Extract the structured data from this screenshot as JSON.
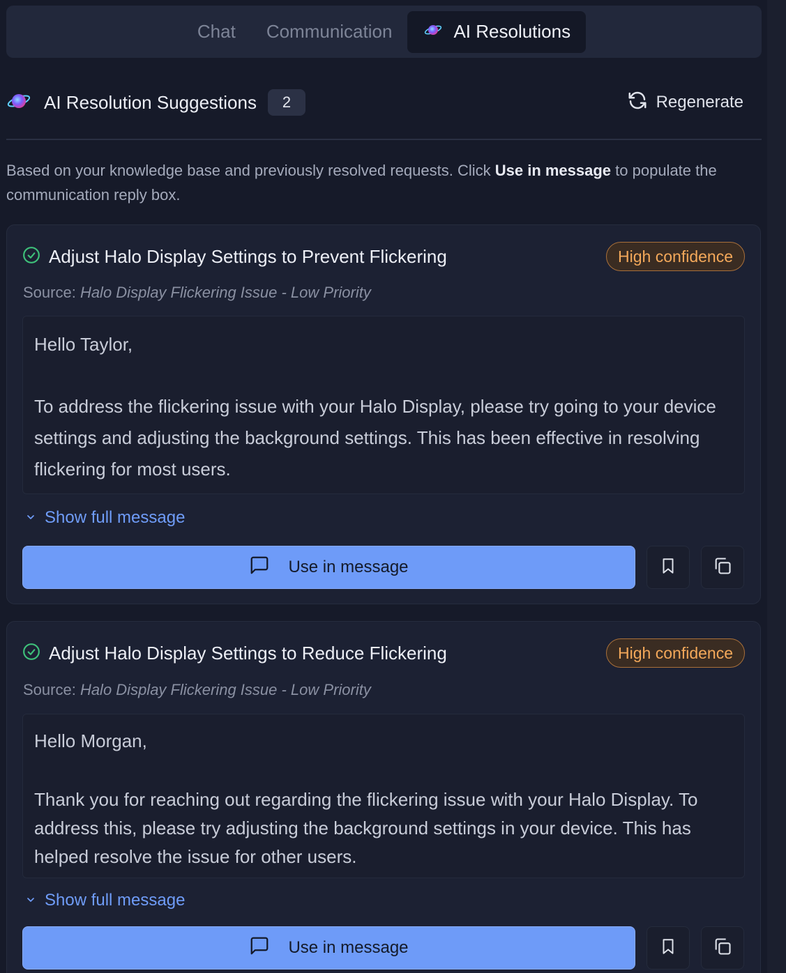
{
  "tabs": [
    {
      "label": "Chat"
    },
    {
      "label": "Communication"
    },
    {
      "label": "AI Resolutions"
    }
  ],
  "header": {
    "title": "AI Resolution Suggestions",
    "count": "2",
    "regenerate_label": "Regenerate"
  },
  "intro": {
    "before": "Based on your knowledge base and previously resolved requests. Click ",
    "bold": "Use in message",
    "after": " to populate the communication reply box."
  },
  "suggestions": [
    {
      "title": "Adjust Halo Display Settings to Prevent Flickering",
      "confidence": "High confidence",
      "source_label": "Source: ",
      "source": "Halo Display Flickering Issue - Low Priority",
      "greeting": "Hello Taylor,",
      "body": "To address the flickering issue with your Halo Display, please try going to your device settings and adjusting the background settings. This has been effective in resolving flickering for most users.",
      "show_full": "Show full message",
      "use_label": "Use in message"
    },
    {
      "title": "Adjust Halo Display Settings to Reduce Flickering",
      "confidence": "High confidence",
      "source_label": "Source: ",
      "source": "Halo Display Flickering Issue - Low Priority",
      "greeting": "Hello Morgan,",
      "body": "Thank you for reaching out regarding the flickering issue with your Halo Display. To address this, please try adjusting the background settings in your device. This has helped resolve the issue for other users.",
      "show_full": "Show full message",
      "use_label": "Use in message"
    }
  ],
  "icons": {
    "ai": "ai-orb-icon",
    "regenerate": "refresh-icon",
    "check": "check-circle-icon",
    "chevron": "chevron-down-icon",
    "message": "message-square-icon",
    "bookmark": "bookmark-icon",
    "copy": "copy-icon"
  },
  "colors": {
    "accent": "#6e9bf8",
    "confidence_text": "#f3a85a",
    "success": "#3ec07a",
    "background": "#161a29"
  }
}
